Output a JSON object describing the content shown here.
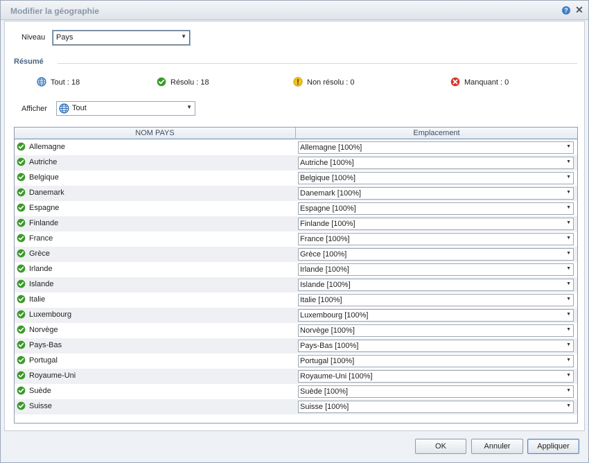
{
  "dialog": {
    "title": "Modifier la géographie"
  },
  "niveau": {
    "label": "Niveau",
    "value": "Pays"
  },
  "resume": {
    "title": "Résumé",
    "items": [
      {
        "icon": "globe-icon",
        "text": "Tout : 18"
      },
      {
        "icon": "check-icon",
        "text": "Résolu : 18"
      },
      {
        "icon": "warning-icon",
        "text": "Non résolu : 0"
      },
      {
        "icon": "error-icon",
        "text": "Manquant : 0"
      }
    ]
  },
  "afficher": {
    "label": "Afficher",
    "value": "Tout"
  },
  "grid": {
    "headers": [
      "NOM PAYS",
      "Emplacement"
    ],
    "rows": [
      {
        "name": "Allemagne",
        "location": "Allemagne [100%]"
      },
      {
        "name": "Autriche",
        "location": "Autriche [100%]"
      },
      {
        "name": "Belgique",
        "location": "Belgique [100%]"
      },
      {
        "name": "Danemark",
        "location": "Danemark [100%]"
      },
      {
        "name": "Espagne",
        "location": "Espagne [100%]"
      },
      {
        "name": "Finlande",
        "location": "Finlande [100%]"
      },
      {
        "name": "France",
        "location": "France [100%]"
      },
      {
        "name": "Grèce",
        "location": "Grèce [100%]"
      },
      {
        "name": "Irlande",
        "location": "Irlande [100%]"
      },
      {
        "name": "Islande",
        "location": "Islande [100%]"
      },
      {
        "name": "Italie",
        "location": "Italie [100%]"
      },
      {
        "name": "Luxembourg",
        "location": "Luxembourg [100%]"
      },
      {
        "name": "Norvège",
        "location": "Norvège [100%]"
      },
      {
        "name": "Pays-Bas",
        "location": "Pays-Bas [100%]"
      },
      {
        "name": "Portugal",
        "location": "Portugal [100%]"
      },
      {
        "name": "Royaume-Uni",
        "location": "Royaume-Uni [100%]"
      },
      {
        "name": "Suède",
        "location": "Suède [100%]"
      },
      {
        "name": "Suisse",
        "location": "Suisse [100%]"
      }
    ]
  },
  "buttons": {
    "ok": "OK",
    "cancel": "Annuler",
    "apply": "Appliquer"
  },
  "colors": {
    "accent": "#4b6583",
    "success": "#3a9a2a",
    "warning": "#f0c020",
    "error": "#d9342b"
  }
}
